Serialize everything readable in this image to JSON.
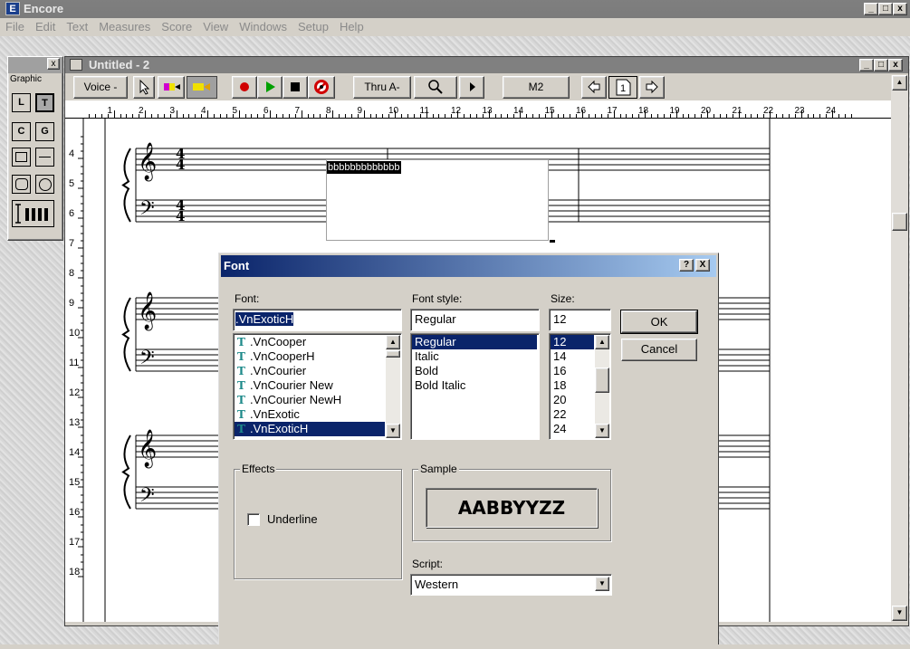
{
  "app": {
    "title": "Encore",
    "icon_letter": "E",
    "menu": [
      "File",
      "Edit",
      "Text",
      "Measures",
      "Score",
      "View",
      "Windows",
      "Setup",
      "Help"
    ]
  },
  "palette": {
    "title": "Graphic",
    "tools": [
      "L",
      "T",
      "C",
      "G"
    ]
  },
  "document": {
    "title": "Untitled - 2",
    "toolbar": {
      "voice": "Voice -",
      "thru": "Thru A-",
      "measure": "M2",
      "page": "1"
    },
    "ruler_numbers": [
      "1",
      "2",
      "3",
      "4",
      "5",
      "6",
      "7",
      "8",
      "9",
      "10",
      "11",
      "12",
      "13",
      "14",
      "15",
      "16",
      "17",
      "18",
      "19",
      "20",
      "21",
      "22",
      "23",
      "24"
    ],
    "line_numbers": [
      "4",
      "5",
      "6",
      "7",
      "8",
      "9",
      "10",
      "11",
      "12",
      "13",
      "14",
      "15",
      "16",
      "17",
      "18"
    ],
    "text_block": "bbbbbbbbbbbbb",
    "time_sig_top": "4",
    "time_sig_bottom": "4",
    "time_sig_top_bass": "4",
    "time_sig_bottom_bass": "4"
  },
  "dialog": {
    "title": "Font",
    "help_btn": "?",
    "close_btn": "X",
    "font_label": "Font:",
    "font_value": ".VnExoticH",
    "font_list": [
      ".VnCooper",
      ".VnCooperH",
      ".VnCourier",
      ".VnCourier New",
      ".VnCourier NewH",
      ".VnExotic",
      ".VnExoticH"
    ],
    "font_selected_index": 6,
    "style_label": "Font style:",
    "style_value": "Regular",
    "style_list": [
      "Regular",
      "Italic",
      "Bold",
      "Bold Italic"
    ],
    "style_selected_index": 0,
    "size_label": "Size:",
    "size_value": "12",
    "size_list": [
      "12",
      "14",
      "16",
      "18",
      "20",
      "22",
      "24"
    ],
    "size_selected_index": 0,
    "ok": "OK",
    "cancel": "Cancel",
    "effects_label": "Effects",
    "underline_label": "Underline",
    "underline_checked": false,
    "sample_label": "Sample",
    "sample_text": "AABBYYZZ",
    "script_label": "Script:",
    "script_value": "Western"
  },
  "colors": {
    "dialog_title_start": "#0a246a",
    "dialog_title_end": "#a6caf0",
    "selection": "#0a246a",
    "record_red": "#d00000",
    "play_green": "#00a000"
  }
}
